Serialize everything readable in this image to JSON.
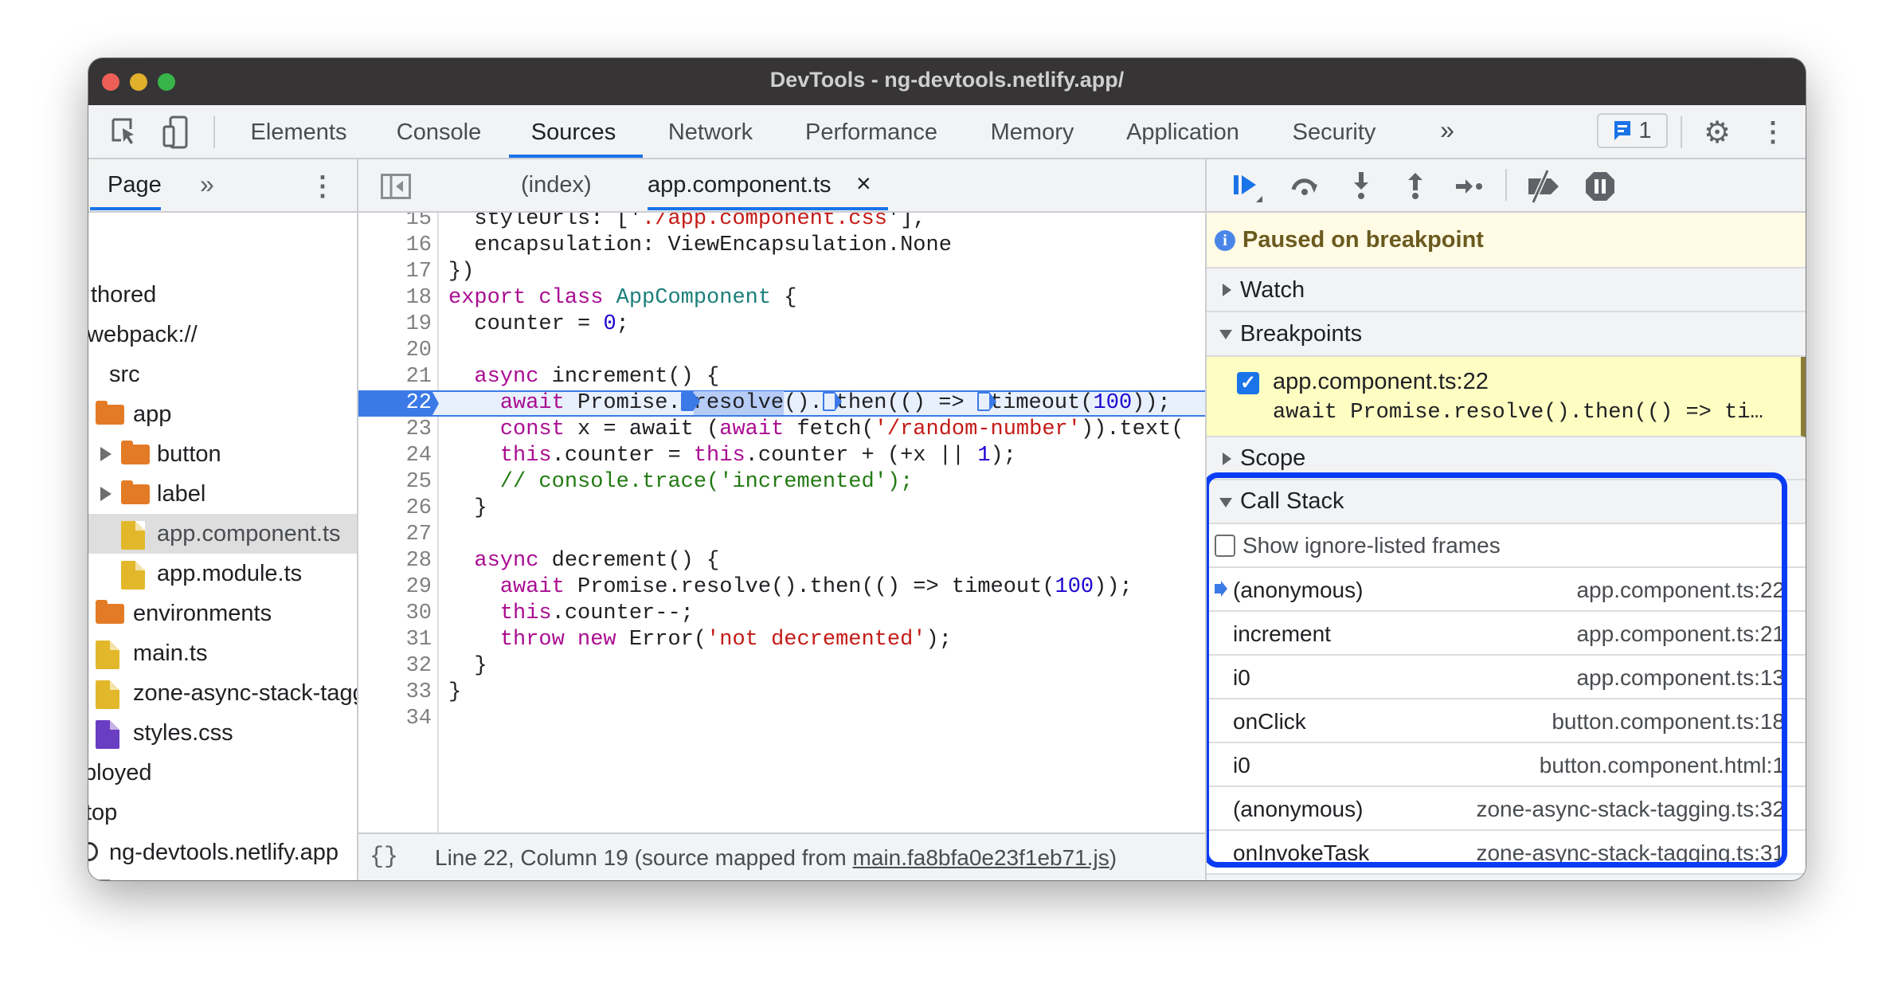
{
  "window": {
    "title": "DevTools - ng-devtools.netlify.app/"
  },
  "toolbar": {
    "tabs": [
      {
        "label": "Elements"
      },
      {
        "label": "Console"
      },
      {
        "label": "Sources"
      },
      {
        "label": "Network"
      },
      {
        "label": "Performance"
      },
      {
        "label": "Memory"
      },
      {
        "label": "Application"
      },
      {
        "label": "Security"
      }
    ],
    "more": "»",
    "issues_count": "1",
    "accent": "#1a73e8"
  },
  "navigator": {
    "tab": "Page",
    "more": "»",
    "items": [
      {
        "label": "thored",
        "type": "text"
      },
      {
        "label": "webpack://",
        "type": "text"
      },
      {
        "label": "src",
        "type": "folder"
      },
      {
        "label": "app",
        "type": "folder"
      },
      {
        "label": "button",
        "type": "folder",
        "collapsed": true
      },
      {
        "label": "label",
        "type": "folder",
        "collapsed": true
      },
      {
        "label": "app.component.ts",
        "type": "file-ts",
        "selected": true
      },
      {
        "label": "app.module.ts",
        "type": "file-ts"
      },
      {
        "label": "environments",
        "type": "folder"
      },
      {
        "label": "main.ts",
        "type": "file-ts"
      },
      {
        "label": "zone-async-stack-tagging.ts",
        "type": "file-ts"
      },
      {
        "label": "styles.css",
        "type": "file-css"
      },
      {
        "label": "ployed",
        "type": "text"
      },
      {
        "label": "top",
        "type": "text"
      },
      {
        "label": "ng-devtools.netlify.app",
        "type": "cloud"
      },
      {
        "label": "(index)",
        "type": "file-doc"
      },
      {
        "label": "main.fa8bfa0e23f1eb71.js",
        "type": "file-ts"
      }
    ]
  },
  "editor": {
    "tabs": [
      {
        "label": "(index)"
      },
      {
        "label": "app.component.ts",
        "closable": true
      }
    ],
    "close": "×",
    "current_line": 22,
    "lines": [
      {
        "n": "15",
        "t": [
          [
            "  styleUrls: ['",
            ""
          ],
          [
            "./app.component.css",
            "s"
          ],
          [
            "'],",
            ""
          ]
        ]
      },
      {
        "n": "16",
        "t": [
          [
            "  encapsulation: ViewEncapsulation.None",
            ""
          ]
        ]
      },
      {
        "n": "17",
        "t": [
          [
            "})",
            ""
          ]
        ]
      },
      {
        "n": "18",
        "t": [
          [
            "export class ",
            "k"
          ],
          [
            "AppComponent",
            "c"
          ],
          [
            " {",
            ""
          ]
        ]
      },
      {
        "n": "19",
        "t": [
          [
            "  counter = ",
            ""
          ],
          [
            "0",
            "n"
          ],
          [
            ";",
            ""
          ]
        ]
      },
      {
        "n": "20",
        "t": []
      },
      {
        "n": "21",
        "t": [
          [
            "  ",
            ""
          ],
          [
            "async",
            "k"
          ],
          [
            " increment() {",
            ""
          ]
        ]
      },
      {
        "n": "22",
        "t": [
          [
            "    ",
            ""
          ],
          [
            "await",
            "k"
          ],
          [
            " Promise.",
            ""
          ],
          [
            "",
            "bpm on"
          ],
          [
            "resolve",
            "hl"
          ],
          [
            "().",
            ""
          ],
          [
            "",
            "bpm"
          ],
          [
            "then(() => ",
            ""
          ],
          [
            "",
            "bpm"
          ],
          [
            "timeout(",
            ""
          ],
          [
            "100",
            "n"
          ],
          [
            "));",
            ""
          ]
        ]
      },
      {
        "n": "23",
        "t": [
          [
            "    ",
            ""
          ],
          [
            "const",
            "k"
          ],
          [
            " x = await (",
            ""
          ],
          [
            "await",
            "k"
          ],
          [
            " fetch(",
            ""
          ],
          [
            "'/random-number'",
            "s"
          ],
          [
            ")).text(",
            ""
          ]
        ]
      },
      {
        "n": "24",
        "t": [
          [
            "    ",
            ""
          ],
          [
            "this",
            "k"
          ],
          [
            ".counter = ",
            ""
          ],
          [
            "this",
            "k"
          ],
          [
            ".counter + (+x || ",
            ""
          ],
          [
            "1",
            "n"
          ],
          [
            ");",
            ""
          ]
        ]
      },
      {
        "n": "25",
        "t": [
          [
            "    // console.trace('incremented');",
            "cm"
          ]
        ]
      },
      {
        "n": "26",
        "t": [
          [
            "  }",
            ""
          ]
        ]
      },
      {
        "n": "27",
        "t": []
      },
      {
        "n": "28",
        "t": [
          [
            "  ",
            ""
          ],
          [
            "async",
            "k"
          ],
          [
            " decrement() {",
            ""
          ]
        ]
      },
      {
        "n": "29",
        "t": [
          [
            "    ",
            ""
          ],
          [
            "await",
            "k"
          ],
          [
            " Promise.resolve().then(() => timeout(",
            ""
          ],
          [
            "100",
            "n"
          ],
          [
            "));",
            ""
          ]
        ]
      },
      {
        "n": "30",
        "t": [
          [
            "    ",
            ""
          ],
          [
            "this",
            "k"
          ],
          [
            ".counter--;",
            ""
          ]
        ]
      },
      {
        "n": "31",
        "t": [
          [
            "    ",
            ""
          ],
          [
            "throw new",
            "k"
          ],
          [
            " Error(",
            ""
          ],
          [
            "'not decremented'",
            "s"
          ],
          [
            ");",
            ""
          ]
        ]
      },
      {
        "n": "32",
        "t": [
          [
            "  }",
            ""
          ]
        ]
      },
      {
        "n": "33",
        "t": [
          [
            "}",
            ""
          ]
        ]
      },
      {
        "n": "34",
        "t": []
      }
    ],
    "status": {
      "format": "{}",
      "position": "Line 22, Column 19",
      "mapped_prefix": "(source mapped from ",
      "mapped_file": "main.fa8bfa0e23f1eb71.js",
      "mapped_suffix": ")"
    }
  },
  "debugger": {
    "paused": "Paused on breakpoint",
    "watch": "Watch",
    "breakpoints": {
      "label": "Breakpoints",
      "items": [
        {
          "file": "app.component.ts:22",
          "code": "await Promise.resolve().then(() => ti…",
          "checked": true
        }
      ]
    },
    "scope": "Scope",
    "call_stack": {
      "label": "Call Stack",
      "show_ignored": "Show ignore-listed frames",
      "show_ignored_checked": false,
      "frames": [
        {
          "name": "(anonymous)",
          "location": "app.component.ts:22",
          "current": true
        },
        {
          "name": "increment",
          "location": "app.component.ts:21"
        },
        {
          "name": "i0",
          "location": "app.component.ts:13"
        },
        {
          "name": "onClick",
          "location": "button.component.ts:18"
        },
        {
          "name": "i0",
          "location": "button.component.html:1"
        },
        {
          "name": "(anonymous)",
          "location": "zone-async-stack-tagging.ts:32"
        },
        {
          "name": "onInvokeTask",
          "location": "zone-async-stack-tagging.ts:31"
        }
      ],
      "highlight_color": "#0a3cf5"
    }
  }
}
